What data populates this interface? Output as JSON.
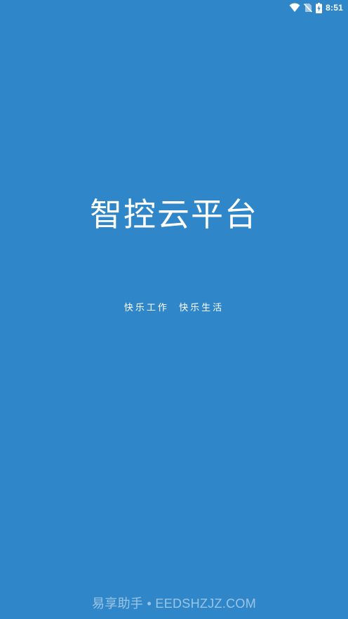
{
  "status_bar": {
    "time": "8:51",
    "icons": [
      "wifi-icon",
      "no-sim-icon",
      "battery-charging-icon"
    ]
  },
  "splash": {
    "title": "智控云平台",
    "slogan": "快乐工作  快乐生活"
  },
  "watermark": {
    "text": "易享助手 • EEDSHZJZ.COM"
  },
  "colors": {
    "background": "#2f86c8",
    "text": "#ffffff"
  }
}
